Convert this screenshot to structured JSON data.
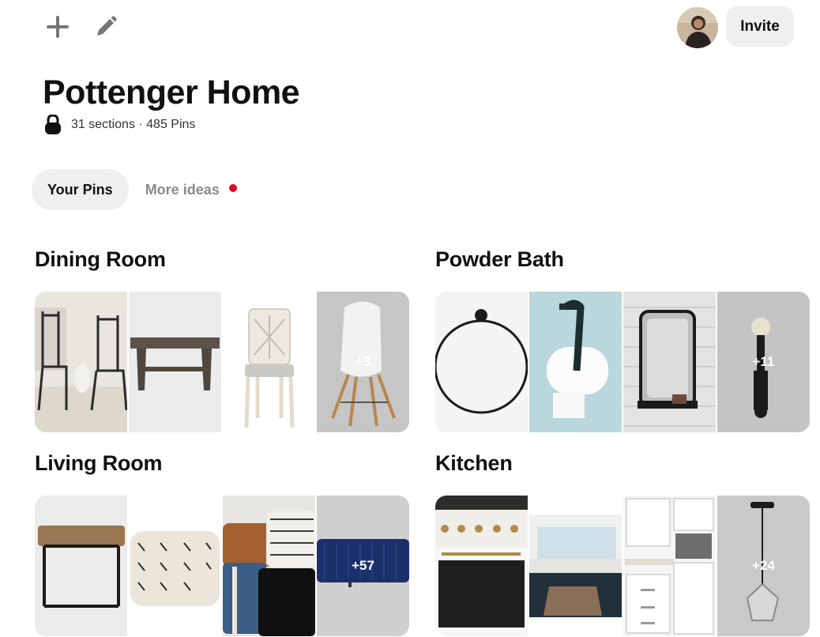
{
  "toolbar": {
    "add_icon": "plus-icon",
    "edit_icon": "pencil-icon",
    "invite_label": "Invite"
  },
  "board": {
    "title": "Pottenger Home",
    "meta": "31 sections · 485 Pins",
    "privacy_icon": "lock-icon"
  },
  "tabs": [
    {
      "label": "Your Pins",
      "active": true
    },
    {
      "label": "More ideas",
      "active": false,
      "notification": true
    }
  ],
  "colors": {
    "accent": "#e60023",
    "pill_bg": "#efefef",
    "muted_text": "#8a8a8a"
  },
  "sections": [
    {
      "title": "Dining Room",
      "more": "+3"
    },
    {
      "title": "Powder Bath",
      "more": "+11"
    },
    {
      "title": "Living Room",
      "more": "+57"
    },
    {
      "title": "Kitchen",
      "more": "+24"
    }
  ]
}
